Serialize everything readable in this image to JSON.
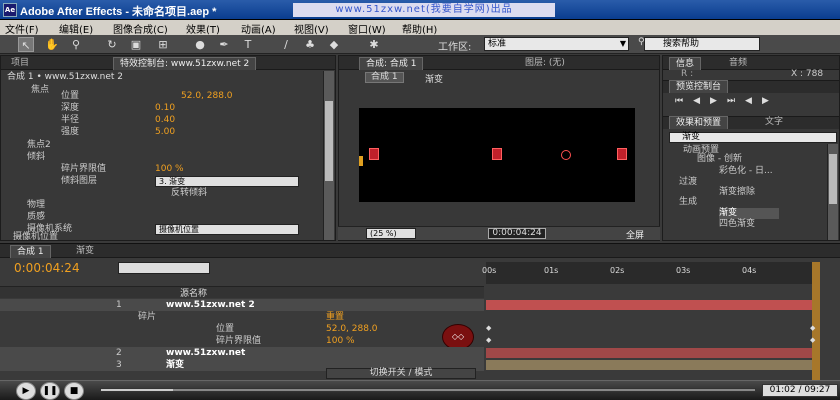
{
  "window": {
    "title": "Adobe After Effects - 未命名项目.aep *",
    "watermark": "www.51zxw.net(我要自学网)出品",
    "logo": "Ae"
  },
  "menu": [
    "文件(F)",
    "编辑(E)",
    "图像合成(C)",
    "效果(T)",
    "动画(A)",
    "视图(V)",
    "窗口(W)",
    "帮助(H)"
  ],
  "toolbar": {
    "workspace_label": "工作区:",
    "workspace_value": "标准",
    "search_help": "搜索帮助"
  },
  "left_panel": {
    "tabs": [
      "项目",
      "特效控制台: www.51zxw.net 2"
    ],
    "crumb": "合成 1 • www.51zxw.net 2",
    "rows": [
      {
        "name": "焦点",
        "value": ""
      },
      {
        "name": "位置",
        "value": "52.0, 288.0"
      },
      {
        "name": "深度",
        "value": "0.10"
      },
      {
        "name": "半径",
        "value": "0.40"
      },
      {
        "name": "强度",
        "value": "5.00"
      },
      {
        "name": "焦点2",
        "value": ""
      },
      {
        "name": "倾斜",
        "value": ""
      },
      {
        "name": "碎片界限值",
        "value": "100 %"
      },
      {
        "name": "倾斜图层",
        "value": "3. 渐变"
      },
      {
        "name": "反转倾斜",
        "value": ""
      },
      {
        "name": "物理",
        "value": ""
      },
      {
        "name": "质感",
        "value": ""
      },
      {
        "name": "摄像机系统",
        "value": "摄像机位置"
      },
      {
        "name": "摄像机位置",
        "value": ""
      }
    ]
  },
  "viewer": {
    "tabs": [
      "合成: 合成 1",
      "图层: (无)"
    ],
    "sub_tab": "合成 1",
    "sub_label": "渐变",
    "zoom": "(25 %)",
    "timecode": "0:00:04:24",
    "view": "全屏"
  },
  "right_panel": {
    "info_tabs": [
      "信息",
      "音频"
    ],
    "info_r": "R :",
    "info_x": "X : 788",
    "preview_tab": "预览控制台",
    "effects_tabs": [
      "效果和预置",
      "文字"
    ],
    "search": "渐变",
    "tree": [
      "动画预置",
      "图像 - 创新",
      "彩色化 - 日...",
      "过渡",
      "渐变擦除",
      "生成",
      "渐变",
      "四色渐变"
    ]
  },
  "timeline": {
    "tabs": [
      "合成 1",
      "渐变"
    ],
    "timecode": "0:00:04:24",
    "ruler": [
      "00s",
      "01s",
      "02s",
      "03s",
      "04s"
    ],
    "col_header": "源名称",
    "layers": [
      {
        "num": "1",
        "name": "www.51zxw.net 2"
      },
      {
        "num": "",
        "name": "碎片",
        "sub": "重置"
      },
      {
        "num": "",
        "name": "位置",
        "sub": "52.0, 288.0"
      },
      {
        "num": "",
        "name": "碎片界限值",
        "sub": "100 %"
      },
      {
        "num": "2",
        "name": "www.51zxw.net"
      },
      {
        "num": "3",
        "name": "渐变"
      }
    ],
    "switch_label": "切换开关 / 模式"
  },
  "player": {
    "time": "01:02 / 09:27",
    "progress": 0.11
  }
}
